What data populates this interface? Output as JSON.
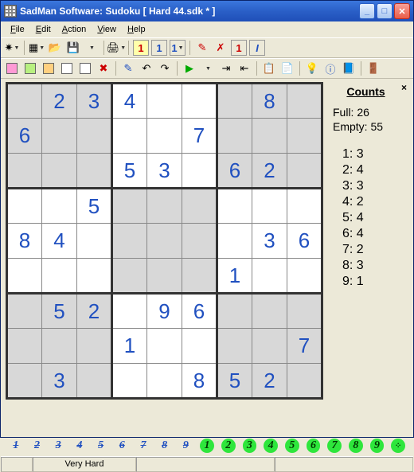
{
  "window": {
    "title": "SadMan Software: Sudoku [ Hard 44.sdk * ]"
  },
  "menu": {
    "file": "File",
    "edit": "Edit",
    "action": "Action",
    "view": "View",
    "help": "Help"
  },
  "counts": {
    "title": "Counts",
    "full_label": "Full:",
    "full_value": "26",
    "empty_label": "Empty:",
    "empty_value": "55",
    "digits": [
      {
        "d": "1",
        "c": "3"
      },
      {
        "d": "2",
        "c": "4"
      },
      {
        "d": "3",
        "c": "3"
      },
      {
        "d": "4",
        "c": "2"
      },
      {
        "d": "5",
        "c": "4"
      },
      {
        "d": "6",
        "c": "4"
      },
      {
        "d": "7",
        "c": "2"
      },
      {
        "d": "8",
        "c": "3"
      },
      {
        "d": "9",
        "c": "1"
      }
    ]
  },
  "difficulty": "Very Hard",
  "grid": [
    [
      "",
      "2",
      "3",
      "4",
      "",
      "",
      "",
      "8",
      ""
    ],
    [
      "6",
      "",
      "",
      "",
      "",
      "7",
      "",
      "",
      ""
    ],
    [
      "",
      "",
      "",
      "5",
      "3",
      "",
      "6",
      "2",
      ""
    ],
    [
      "",
      "",
      "5",
      "",
      "",
      "",
      "",
      "",
      ""
    ],
    [
      "8",
      "4",
      "",
      "",
      "",
      "",
      "",
      "3",
      "6"
    ],
    [
      "",
      "",
      "",
      "",
      "",
      "",
      "1",
      "",
      ""
    ],
    [
      "",
      "5",
      "2",
      "",
      "9",
      "6",
      "",
      "",
      ""
    ],
    [
      "",
      "",
      "",
      "1",
      "",
      "",
      "",
      "",
      "7"
    ],
    [
      "",
      "3",
      "",
      "",
      "",
      "8",
      "5",
      "2",
      ""
    ]
  ],
  "candidates": {
    "off": [
      "1",
      "2",
      "3",
      "4",
      "5",
      "6",
      "7",
      "8",
      "9"
    ],
    "on": [
      "1",
      "2",
      "3",
      "4",
      "5",
      "6",
      "7",
      "8",
      "9"
    ]
  },
  "colors": [
    "#ff9ad5",
    "#b8f080",
    "#ffd080",
    "#ffffff",
    "#ffffff"
  ],
  "toolbar_icons": {
    "new": "✷",
    "grid": "▦",
    "open": "📂",
    "save": "💾",
    "print": "🖨",
    "num_box": "1",
    "undo": "↶",
    "redo": "↷",
    "play": "▶",
    "step": "⇥",
    "copy": "📋",
    "paste": "📄",
    "hint": "💡",
    "info": "ⓘ",
    "book": "📘",
    "exit": "🚪"
  }
}
